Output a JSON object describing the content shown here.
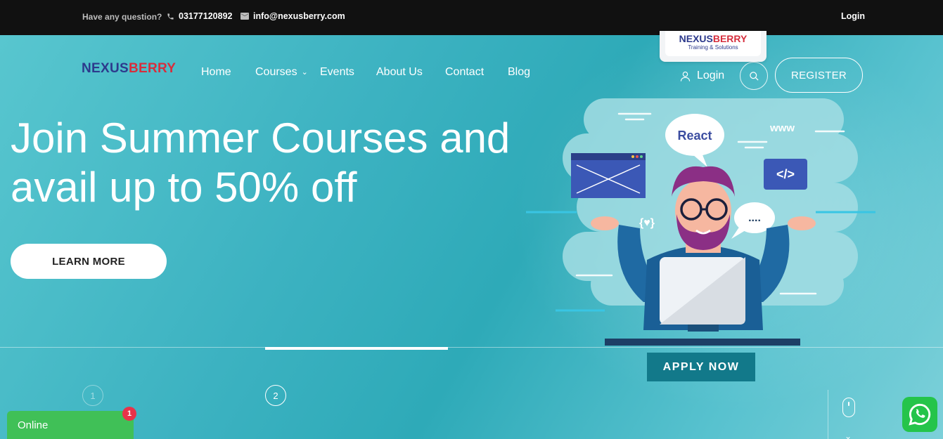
{
  "topbar": {
    "question": "Have any question?",
    "phone": "03177120892",
    "email": "info@nexusberry.com",
    "login": "Login"
  },
  "logo": {
    "part1": "NEXUS",
    "part2": "BERRY"
  },
  "logo_card": {
    "part1": "NEXUS",
    "part2": "BERRY",
    "tagline": "Training & Solutions"
  },
  "nav": {
    "items": [
      {
        "label": "Home"
      },
      {
        "label": "Courses"
      },
      {
        "label": "Events"
      },
      {
        "label": "About Us"
      },
      {
        "label": "Contact"
      },
      {
        "label": "Blog"
      }
    ],
    "login": "Login",
    "register": "REGISTER"
  },
  "hero": {
    "headline_line1": "Join Summer Courses and",
    "headline_line2": "avail up to 50% off",
    "cta": "LEARN MORE",
    "apply": "APPLY NOW",
    "illustration": {
      "bubble_react": "React",
      "www": "www",
      "code_tag": "</>",
      "dots": "....",
      "braces": "{♥}"
    }
  },
  "slider": {
    "slides": [
      "1",
      "2"
    ],
    "active": 2
  },
  "chat": {
    "status": "Online",
    "count": "1"
  },
  "colors": {
    "topbar": "#111111",
    "hero": "#3fb3c4",
    "brand_blue": "#2d3a8c",
    "brand_red": "#d62e3d",
    "apply_bg": "#12798a",
    "online_green": "#40c057",
    "badge_red": "#e8334a",
    "whatsapp_green": "#25c44a"
  }
}
